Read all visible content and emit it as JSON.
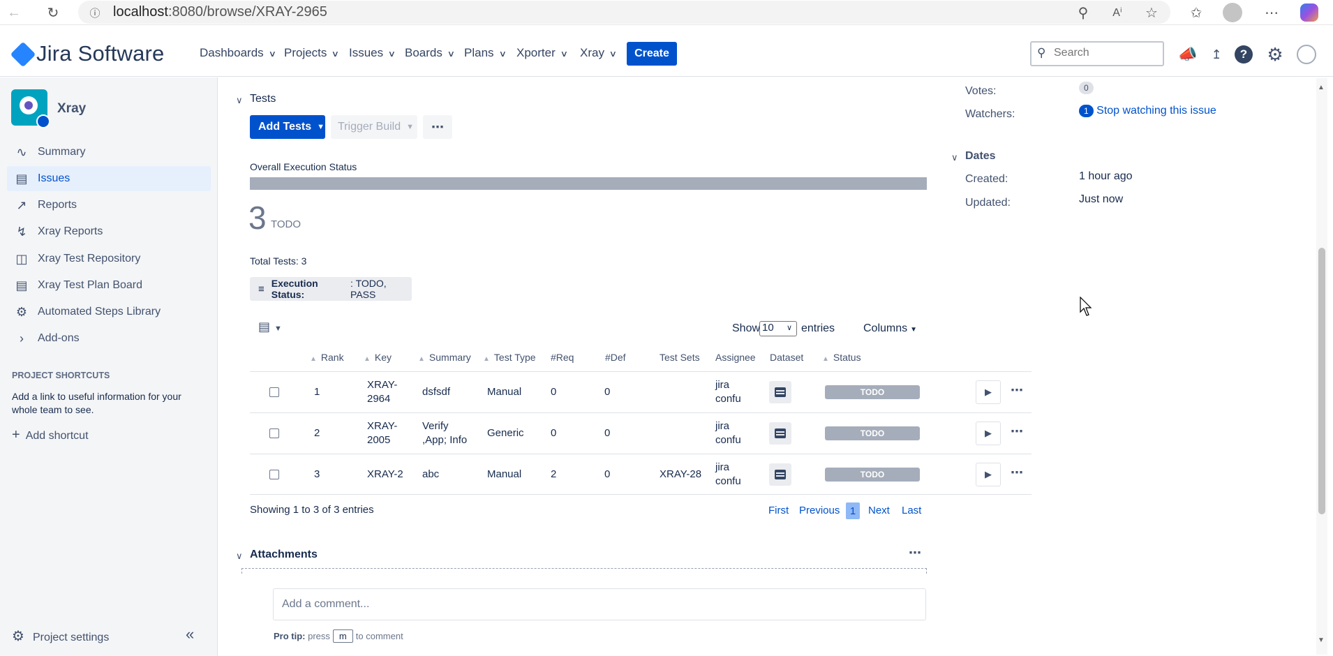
{
  "browser": {
    "url_host": "localhost",
    "url_rest": ":8080/browse/XRAY-2965"
  },
  "header": {
    "product": "Jira Software",
    "nav": [
      "Dashboards",
      "Projects",
      "Issues",
      "Boards",
      "Plans",
      "Xporter",
      "Xray"
    ],
    "create_label": "Create",
    "search_placeholder": "Search"
  },
  "sidebar": {
    "project_name": "Xray",
    "items": [
      {
        "label": "Summary",
        "icon": "pulse-icon"
      },
      {
        "label": "Issues",
        "icon": "issues-icon"
      },
      {
        "label": "Reports",
        "icon": "chart-icon"
      },
      {
        "label": "Xray Reports",
        "icon": "bolt-icon"
      },
      {
        "label": "Xray Test Repository",
        "icon": "repository-icon"
      },
      {
        "label": "Xray Test Plan Board",
        "icon": "board-icon"
      },
      {
        "label": "Automated Steps Library",
        "icon": "library-icon"
      },
      {
        "label": "Add-ons",
        "icon": "chevron-right-icon"
      }
    ],
    "shortcuts_title": "PROJECT SHORTCUTS",
    "shortcuts_desc": "Add a link to useful information for your whole team to see.",
    "add_shortcut": "Add shortcut",
    "project_settings": "Project settings"
  },
  "tests": {
    "title": "Tests",
    "add_tests": "Add Tests",
    "trigger_build": "Trigger Build",
    "overall_status_label": "Overall Execution Status",
    "todo_count": "3",
    "todo_label": "TODO",
    "total_tests": "Total Tests: 3",
    "filter_label": "Execution Status:",
    "filter_value": ": TODO, PASS",
    "show_label": "Show",
    "show_value": "10",
    "entries_label": "entries",
    "columns_label": "Columns",
    "headers": [
      "Rank",
      "Key",
      "Summary",
      "Test Type",
      "#Req",
      "#Def",
      "Test Sets",
      "Assignee",
      "Dataset",
      "Status"
    ],
    "rows": [
      {
        "rank": "1",
        "key1": "XRAY-",
        "key2": "2964",
        "summary1": "dsfsdf",
        "summary2": "",
        "type": "Manual",
        "req": "0",
        "def": "0",
        "sets": "",
        "assignee1": "jira",
        "assignee2": "confu",
        "status": "TODO"
      },
      {
        "rank": "2",
        "key1": "XRAY-",
        "key2": "2005",
        "summary1": "Verify",
        "summary2": ",App; Info",
        "type": "Generic",
        "req": "0",
        "def": "0",
        "sets": "",
        "assignee1": "jira",
        "assignee2": "confu",
        "status": "TODO"
      },
      {
        "rank": "3",
        "key1": "XRAY-2",
        "key2": "",
        "summary1": "abc",
        "summary2": "",
        "type": "Manual",
        "req": "2",
        "def": "0",
        "sets": "XRAY-28",
        "assignee1": "jira",
        "assignee2": "confu",
        "status": "TODO"
      }
    ],
    "showing": "Showing 1 to 3 of 3 entries",
    "pager": {
      "first": "First",
      "previous": "Previous",
      "current": "1",
      "next": "Next",
      "last": "Last"
    }
  },
  "attachments": {
    "title": "Attachments",
    "comment_placeholder": "Add a comment...",
    "protip_label": "Pro tip:",
    "protip_press": "press",
    "protip_key": "m",
    "protip_rest": "to comment"
  },
  "people": {
    "votes_label": "Votes:",
    "votes_count": "0",
    "watchers_label": "Watchers:",
    "watchers_count": "1",
    "watch_link": "Stop watching this issue"
  },
  "dates": {
    "title": "Dates",
    "created_label": "Created:",
    "created_value": "1 hour ago",
    "updated_label": "Updated:",
    "updated_value": "Just now"
  },
  "colors": {
    "brand": "#0052cc",
    "todo": "#a5adba",
    "sidebar_bg": "#f4f5f7"
  }
}
